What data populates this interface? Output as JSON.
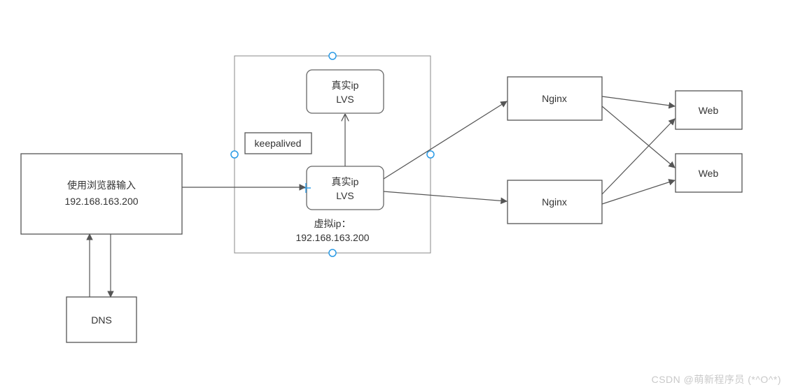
{
  "browser_box": {
    "line1": "使用浏览器输入",
    "line2": "192.168.163.200"
  },
  "dns_box": {
    "label": "DNS"
  },
  "group": {
    "label1": "虚拟ip：",
    "label2": "192.168.163.200",
    "keepalived": "keepalived",
    "lvs_top": {
      "line1": "真实ip",
      "line2": "LVS"
    },
    "lvs_bottom": {
      "line1": "真实ip",
      "line2": "LVS"
    }
  },
  "nginx_top": "Nginx",
  "nginx_bottom": "Nginx",
  "web_top": "Web",
  "web_bottom": "Web",
  "watermark": "CSDN @萌新程序员 (*^O^*)"
}
